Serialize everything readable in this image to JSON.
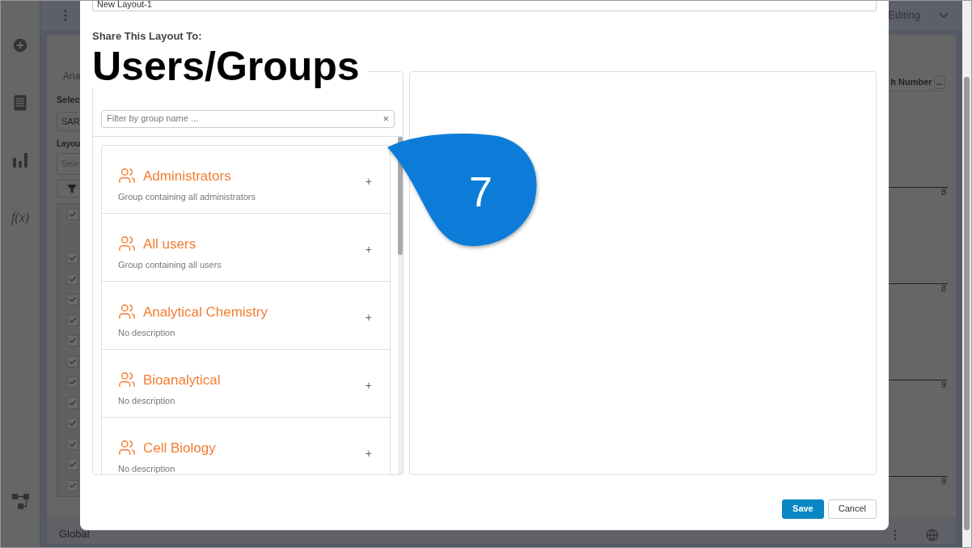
{
  "background": {
    "mode_label": "Editing",
    "panel_title": "Ana",
    "select_label": "Selec",
    "select_value": "SAR",
    "layout_label": "Layou",
    "layout_placeholder": "Sele",
    "formula_label": "f(x)",
    "column_header": "h Number",
    "column_menu": "...",
    "header_check": {
      "checked": true
    },
    "rows": [
      {
        "checked": true
      },
      {
        "checked": true
      },
      {
        "checked": true
      },
      {
        "checked": true
      },
      {
        "checked": true
      },
      {
        "checked": true
      },
      {
        "checked": true
      },
      {
        "checked": true
      },
      {
        "checked": true
      },
      {
        "checked": true
      },
      {
        "checked": true
      },
      {
        "checked": true
      }
    ],
    "column_values": [
      "8",
      "8",
      "9",
      "9"
    ],
    "bottom_tab": "Global"
  },
  "dialog": {
    "name_value": "New Layout-1",
    "share_label": "Share This Layout To:",
    "heading": "Users/Groups",
    "filter": {
      "placeholder": "Filter by group name ...",
      "clear": "×"
    },
    "groups": [
      {
        "name": "Administrators",
        "description": "Group containing all administrators",
        "add": "+"
      },
      {
        "name": "All users",
        "description": "Group containing all users",
        "add": "+"
      },
      {
        "name": "Analytical Chemistry",
        "description": "No description",
        "add": "+"
      },
      {
        "name": "Bioanalytical",
        "description": "No description",
        "add": "+"
      },
      {
        "name": "Cell Biology",
        "description": "No description",
        "add": "+"
      }
    ],
    "buttons": [
      {
        "label": "Save",
        "kind": "primary"
      },
      {
        "label": "Cancel",
        "kind": "secondary"
      }
    ]
  },
  "callout": {
    "number": "7"
  }
}
